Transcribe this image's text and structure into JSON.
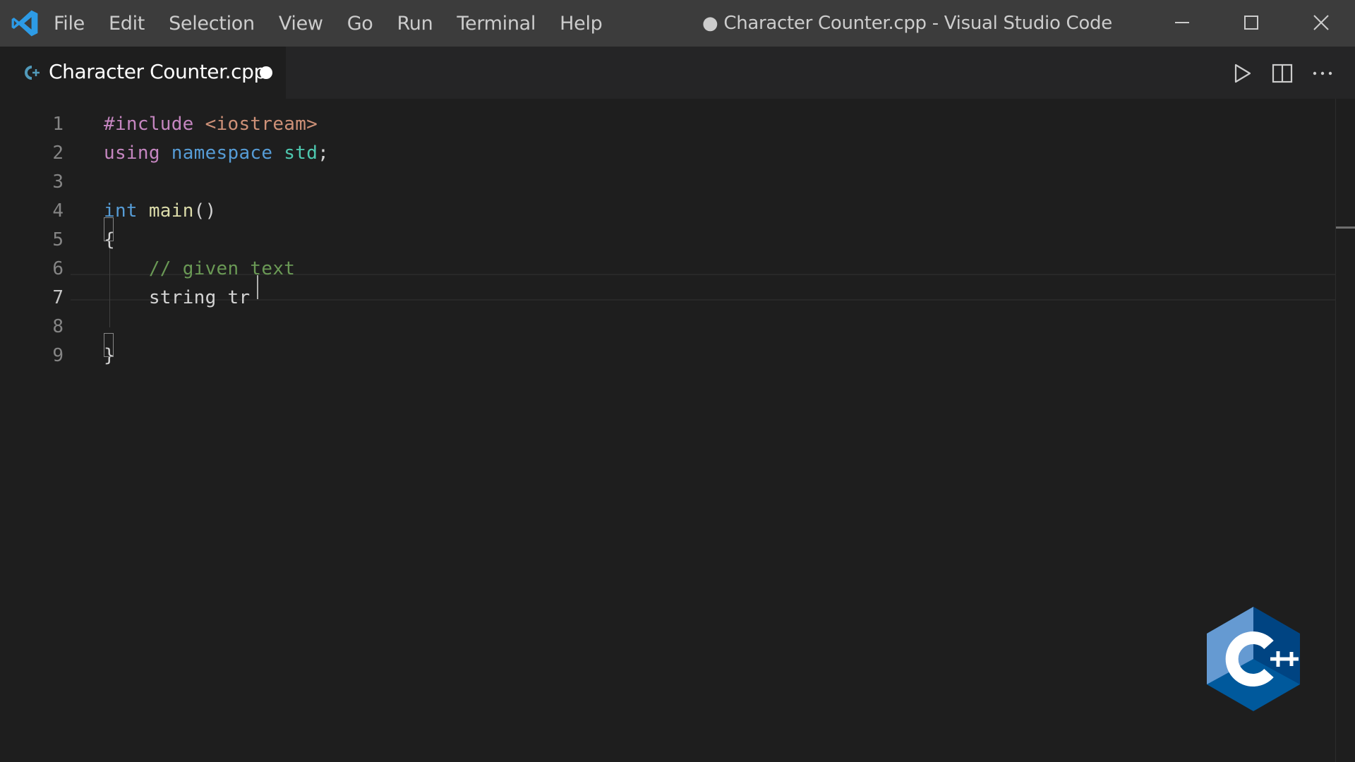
{
  "window": {
    "title": "● Character Counter.cpp - Visual Studio Code"
  },
  "menu": [
    "File",
    "Edit",
    "Selection",
    "View",
    "Go",
    "Run",
    "Terminal",
    "Help"
  ],
  "tab": {
    "label": "Character Counter.cpp",
    "dirty": true
  },
  "editor": {
    "line_numbers": [
      "1",
      "2",
      "3",
      "4",
      "5",
      "6",
      "7",
      "8",
      "9"
    ],
    "active_line": 7,
    "lines": [
      [
        {
          "t": "#include ",
          "c": "tok-directive"
        },
        {
          "t": "<iostream>",
          "c": "tok-string"
        }
      ],
      [
        {
          "t": "using ",
          "c": "tok-keyword-ctrl"
        },
        {
          "t": "namespace ",
          "c": "tok-keyword"
        },
        {
          "t": "std",
          "c": "tok-ns"
        },
        {
          "t": ";",
          "c": "tok-plain"
        }
      ],
      [],
      [
        {
          "t": "int ",
          "c": "tok-keyword"
        },
        {
          "t": "main",
          "c": "tok-func"
        },
        {
          "t": "()",
          "c": "tok-plain"
        }
      ],
      [
        {
          "t": "{",
          "c": "tok-plain"
        }
      ],
      [
        {
          "t": "    ",
          "c": "tok-plain"
        },
        {
          "t": "// given text",
          "c": "tok-comment"
        }
      ],
      [
        {
          "t": "    string tr",
          "c": "tok-plain"
        }
      ],
      [],
      [
        {
          "t": "}",
          "c": "tok-plain"
        }
      ]
    ]
  },
  "icons": {
    "app": "vscode-logo-icon",
    "tab_file": "cpp-file-icon",
    "run": "play-icon",
    "split": "split-editor-icon",
    "more": "more-actions-icon",
    "watermark": "cpp-logo"
  },
  "colors": {
    "titlebar": "#3c3c3c",
    "tabbar": "#252526",
    "editor_bg": "#1e1e1e",
    "vscode_blue": "#2d9be6",
    "cpp_blue": "#00599c"
  }
}
